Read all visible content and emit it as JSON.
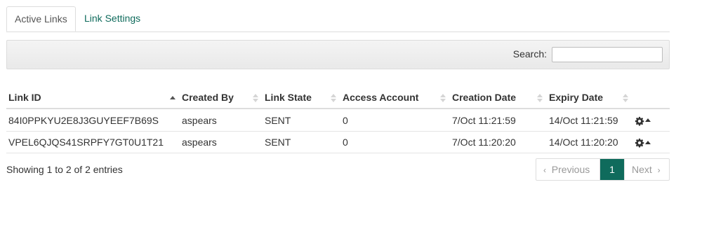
{
  "tabs": [
    {
      "label": "Active Links",
      "active": true
    },
    {
      "label": "Link Settings",
      "active": false
    }
  ],
  "search": {
    "label": "Search:",
    "value": "",
    "placeholder": ""
  },
  "table": {
    "columns": [
      "Link ID",
      "Created By",
      "Link State",
      "Access Account",
      "Creation Date",
      "Expiry Date"
    ],
    "rows": [
      {
        "link_id": "84I0PPKYU2E8J3GUYEEF7B69S",
        "created_by": "aspears",
        "link_state": "SENT",
        "access_account": "0",
        "creation_date": "7/Oct 11:21:59",
        "expiry_date": "14/Oct 11:21:59"
      },
      {
        "link_id": "VPEL6QJQS41SRPFY7GT0U1T21",
        "created_by": "aspears",
        "link_state": "SENT",
        "access_account": "0",
        "creation_date": "7/Oct 11:20:20",
        "expiry_date": "14/Oct 11:20:20"
      }
    ]
  },
  "info": "Showing 1 to 2 of 2 entries",
  "pagination": {
    "previous": "Previous",
    "current": "1",
    "next": "Next"
  },
  "colors": {
    "accent": "#0f6b5c"
  },
  "icons": {
    "row_action": "gear-icon",
    "sort": "sort-icon"
  }
}
